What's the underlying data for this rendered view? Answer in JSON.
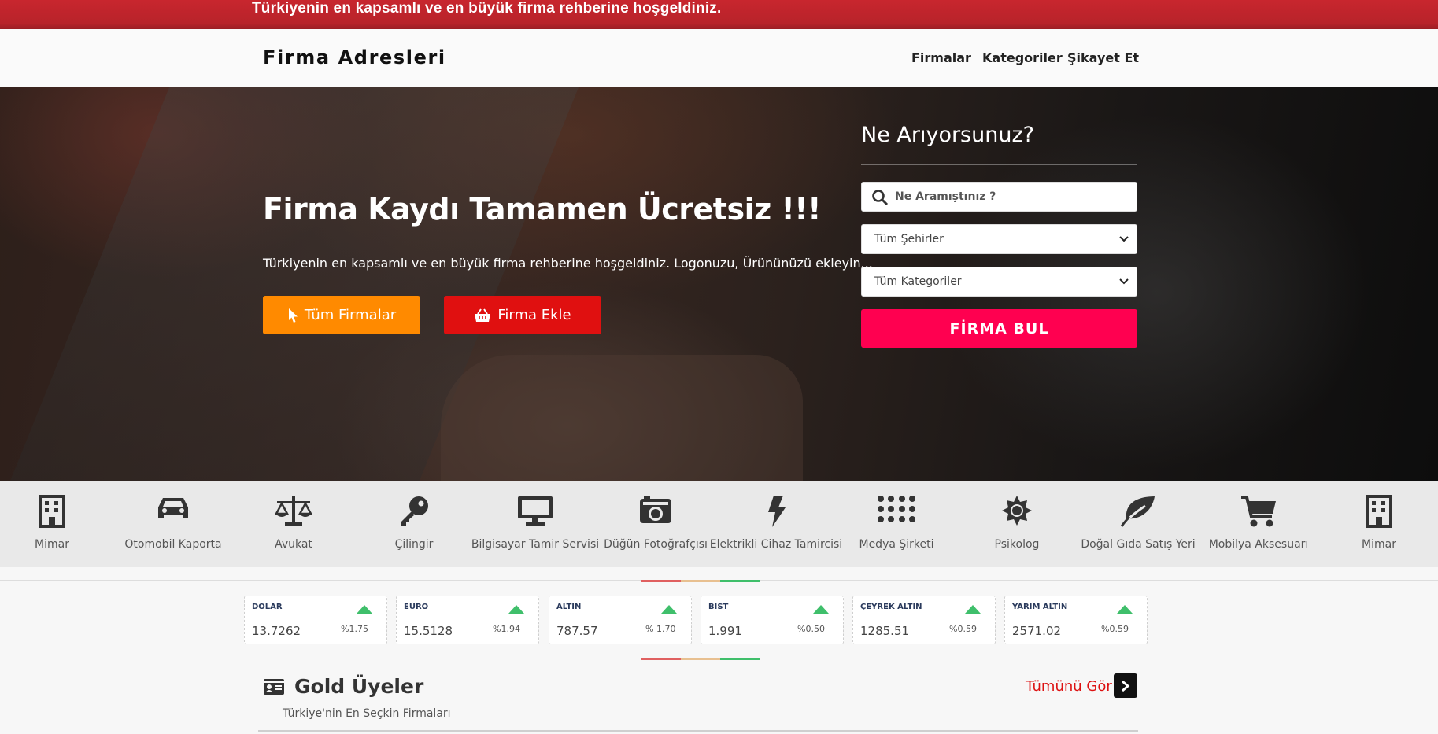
{
  "topbar": {
    "text": "Türkiyenin en kapsamlı ve en büyük firma rehberine hoşgeldiniz."
  },
  "header": {
    "brand": "Firma Adresleri",
    "nav": [
      "Firmalar",
      "Kategoriler",
      "Şikayet Et"
    ]
  },
  "hero": {
    "title": "Firma Kaydı Tamamen Ücretsiz !!!",
    "subtitle": "Türkiyenin en kapsamlı ve en büyük firma rehberine hoşgeldiniz. Logonuzu, Ürününüzü ekleyin...",
    "btn_all": "Tüm Firmalar",
    "btn_add": "Firma Ekle"
  },
  "search": {
    "title": "Ne Arıyorsunuz?",
    "placeholder": "Ne Aramıştınız ?",
    "city_select": "Tüm Şehirler",
    "category_select": "Tüm Kategoriler",
    "button": "FİRMA BUL"
  },
  "categories": [
    {
      "label": "Mimar",
      "icon": "building-icon"
    },
    {
      "label": "Otomobil Kaporta",
      "icon": "car-icon"
    },
    {
      "label": "Avukat",
      "icon": "scale-icon"
    },
    {
      "label": "Çilingir",
      "icon": "key-icon"
    },
    {
      "label": "Bilgisayar Tamir Servisi",
      "icon": "monitor-icon"
    },
    {
      "label": "Düğün Fotoğrafçısı",
      "icon": "camera-icon"
    },
    {
      "label": "Elektrikli Cihaz Tamircisi",
      "icon": "bolt-icon"
    },
    {
      "label": "Medya Şirketi",
      "icon": "dots-grid-icon"
    },
    {
      "label": "Psikolog",
      "icon": "sun-icon"
    },
    {
      "label": "Doğal Gıda Satış Yeri",
      "icon": "leaf-icon"
    },
    {
      "label": "Mobilya Aksesuarı",
      "icon": "cart-icon"
    },
    {
      "label": "Mimar",
      "icon": "building-icon"
    }
  ],
  "tickers": [
    {
      "name": "DOLAR",
      "value": "13.7262",
      "change": "%1.75"
    },
    {
      "name": "EURO",
      "value": "15.5128",
      "change": "%1.94"
    },
    {
      "name": "ALTIN",
      "value": "787.57",
      "change": "% 1.70"
    },
    {
      "name": "BIST",
      "value": "1.991",
      "change": "%0.50"
    },
    {
      "name": "ÇEYREK ALTIN",
      "value": "1285.51",
      "change": "%0.59"
    },
    {
      "name": "YARIM ALTIN",
      "value": "2571.02",
      "change": "%0.59"
    }
  ],
  "gold": {
    "title": "Gold Üyeler",
    "subtitle": "Türkiye'nin En Seçkin Firmaları",
    "see_all": "Tümünü Gör"
  },
  "colors": {
    "topbar": "#b8232a",
    "accent_orange": "#ff8a00",
    "accent_red": "#e01010",
    "find_button": "#ff0050",
    "ticker_up": "#3fbf6b"
  }
}
